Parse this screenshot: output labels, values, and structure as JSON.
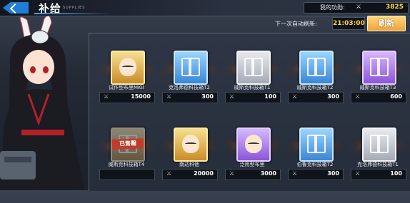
{
  "header": {
    "title": "补给",
    "subtitle": "SUPPLIES",
    "merit_label": "我的功勋:",
    "merit_value": "3825",
    "merit_icon": "crossed-swords-icon"
  },
  "refresh": {
    "label": "下一次自动刷新:",
    "timer": "21:03:00",
    "button_label": "刷新"
  },
  "colors": {
    "accent_blue": "#1f7fd8",
    "gold_text": "#ffd64a",
    "refresh_button": "#f0a23c",
    "sold_stamp": "#c43a2a"
  },
  "currency_icon": "crossed-swords-icon",
  "items": [
    {
      "name": "试作型布里MKII",
      "price": "15000",
      "rarity": "gold",
      "art": "character",
      "sold": false
    },
    {
      "name": "克洛弗德科技箱T2",
      "price": "300",
      "rarity": "blue",
      "art": "box",
      "sold": false
    },
    {
      "name": "威斯克科技箱T1",
      "price": "100",
      "rarity": "gray",
      "art": "box",
      "sold": false
    },
    {
      "name": "威斯克科技箱T2",
      "price": "300",
      "rarity": "blue",
      "art": "box",
      "sold": false
    },
    {
      "name": "威斯克科技箱T3",
      "price": "600",
      "rarity": "purple",
      "art": "box",
      "sold": false
    },
    {
      "name": "威斯克科技箱T4",
      "price": "",
      "rarity": "gold",
      "art": "box",
      "sold": true,
      "sold_label": "已售罄"
    },
    {
      "name": "南达科他",
      "price": "20000",
      "rarity": "gold",
      "art": "character",
      "sold": false
    },
    {
      "name": "泛用型布里",
      "price": "3000",
      "rarity": "purple",
      "art": "character",
      "sold": false
    },
    {
      "name": "伯鲁克科技箱T2",
      "price": "300",
      "rarity": "blue",
      "art": "box",
      "sold": false
    },
    {
      "name": "克洛弗德科技箱T1",
      "price": "100",
      "rarity": "gray",
      "art": "box",
      "sold": false
    }
  ]
}
